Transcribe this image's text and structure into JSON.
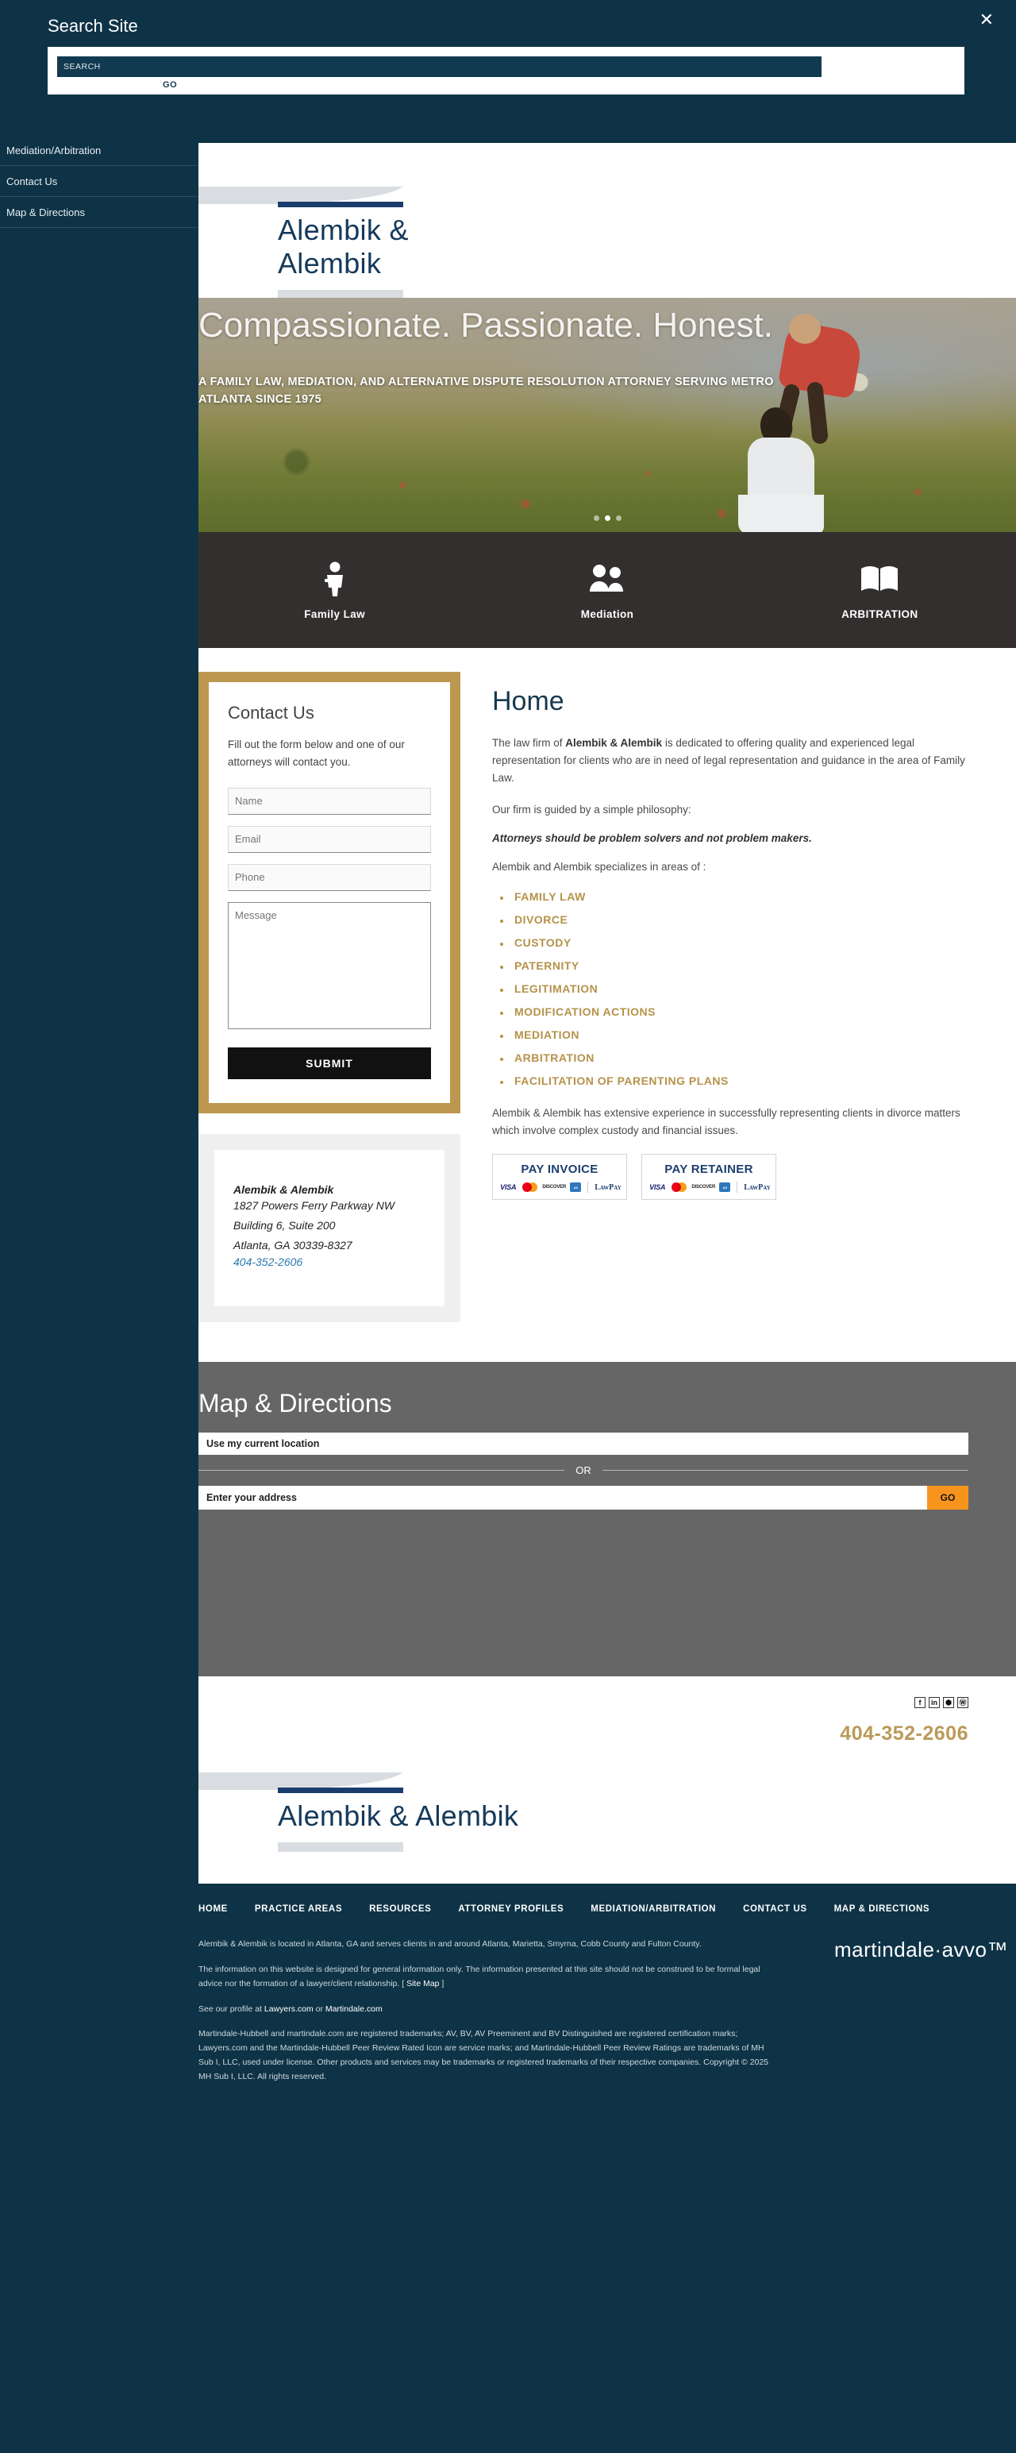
{
  "search_overlay": {
    "title": "Search Site",
    "close_icon": "close-x-icon",
    "input_value": "SEARCH",
    "input_placeholder": "SEARCH",
    "go_label": "GO"
  },
  "slide_nav": {
    "items": [
      {
        "label": "Mediation/Arbitration"
      },
      {
        "label": "Contact Us"
      },
      {
        "label": "Map & Directions"
      }
    ]
  },
  "logo": {
    "name": "Alembik & Alembik"
  },
  "hero": {
    "headline": "Compassionate. Passionate. Honest.",
    "subhead": "A FAMILY LAW, MEDIATION, AND ALTERNATIVE DISPUTE RESOLUTION ATTORNEY SERVING METRO ATLANTA SINCE 1975",
    "dots": [
      false,
      true,
      false
    ]
  },
  "practice": {
    "items": [
      {
        "label": "Family Law",
        "icon": "person-icon"
      },
      {
        "label": "Mediation",
        "icon": "people-group-icon"
      },
      {
        "label": "ARBITRATION",
        "icon": "open-book-icon"
      }
    ]
  },
  "contact_form": {
    "title": "Contact Us",
    "intro": "Fill out the form below and one of our attorneys will contact you.",
    "name_placeholder": "Name",
    "email_placeholder": "Email",
    "phone_placeholder": "Phone",
    "message_placeholder": "Message",
    "submit_label": "SUBMIT"
  },
  "address_card": {
    "firm": "Alembik & Alembik",
    "street": "1827 Powers Ferry Parkway NW",
    "suite": "Building 6, Suite 200",
    "city": "Atlanta, GA 30339-8327",
    "phone": "404-352-2606"
  },
  "main": {
    "title": "Home",
    "para1_pre": "The law firm of ",
    "para1_bold": "Alembik & Alembik",
    "para1_post": " is dedicated to offering quality and experienced legal representation for clients who are in need of legal representation and guidance in the area of Family Law.",
    "para2": "Our firm is guided by a simple philosophy:",
    "philosophy": "Attorneys should be problem solvers and not problem makers.",
    "list_intro": "Alembik and Alembik specializes in areas of :",
    "areas": [
      "FAMILY LAW",
      "DIVORCE",
      "CUSTODY",
      "PATERNITY",
      "LEGITIMATION",
      "MODIFICATION ACTIONS",
      "MEDIATION",
      "ARBITRATION",
      "FACILITATION OF PARENTING PLANS"
    ],
    "closing": "Alembik & Alembik has extensive experience in successfully representing clients in divorce matters which involve complex custody and financial issues.",
    "pay_buttons": [
      {
        "label": "PAY INVOICE",
        "brand": "LawPay"
      },
      {
        "label": "PAY RETAINER",
        "brand": "LawPay"
      }
    ],
    "card_brands": [
      "VISA",
      "Mastercard",
      "DISCOVER",
      "AMEX"
    ]
  },
  "map_section": {
    "title": "Map & Directions",
    "current_location_label": "Use my current location",
    "or_label": "OR",
    "address_placeholder": "Enter your address",
    "go_label": "GO"
  },
  "footer_upper": {
    "social": [
      {
        "name": "facebook-icon",
        "glyph": "f"
      },
      {
        "name": "linkedin-icon",
        "glyph": "in"
      },
      {
        "name": "justia-icon",
        "glyph": "⬢"
      },
      {
        "name": "avvo-icon",
        "glyph": "Ⓦ"
      }
    ],
    "phone": "404-352-2606",
    "logo_name": "Alembik & Alembik"
  },
  "footer_dark": {
    "nav": [
      "HOME",
      "PRACTICE AREAS",
      "RESOURCES",
      "ATTORNEY PROFILES",
      "MEDIATION/ARBITRATION",
      "CONTACT US",
      "MAP & DIRECTIONS"
    ],
    "line1": "Alembik & Alembik is located in Atlanta, GA and serves clients in and around Atlanta, Marietta, Smyrna, Cobb County and Fulton County.",
    "line2_pre": "The information on this website is designed for general information only. The information presented at this site should not be construed to be formal legal advice nor the formation of a lawyer/client relationship. [ ",
    "line2_link": "Site Map",
    "line2_post": " ]",
    "line3_pre": "See our profile at ",
    "line3_link1": "Lawyers.com",
    "line3_mid": " or ",
    "line3_link2": "Martindale.com",
    "line4": "Martindale-Hubbell and martindale.com are registered trademarks; AV, BV, AV Preeminent and BV Distinguished are registered certification marks; Lawyers.com and the Martindale-Hubbell Peer Review Rated Icon are service marks; and Martindale-Hubbell Peer Review Ratings are trademarks of MH Sub I, LLC, used under license. Other products and services may be trademarks or registered trademarks of their respective companies. Copyright © 2025 MH Sub I, LLC. All rights reserved.",
    "brand_logo": "martindale·avvo™"
  },
  "colors": {
    "navy": "#0e3346",
    "gold": "#b59249",
    "dark_strip": "#332f2e",
    "grey_map": "#666666",
    "orange": "#f7941e",
    "link_blue": "#2a7ab0"
  }
}
